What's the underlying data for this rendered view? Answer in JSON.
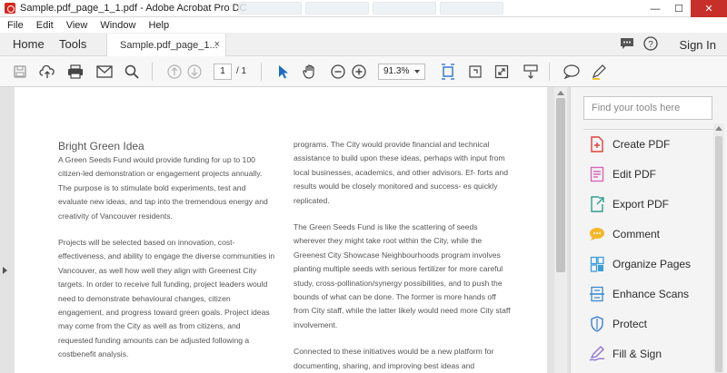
{
  "window": {
    "title": "Sample.pdf_page_1_1.pdf - Adobe Acrobat Pro DC",
    "minimize": "—",
    "maximize": "☐",
    "close": "✕"
  },
  "menu": [
    "File",
    "Edit",
    "View",
    "Window",
    "Help"
  ],
  "tabs": {
    "home": "Home",
    "tools": "Tools",
    "document": "Sample.pdf_page_1...",
    "document_close": "×",
    "sign_in": "Sign In"
  },
  "toolbar": {
    "page_current": "1",
    "page_total": "/ 1",
    "zoom": "91.3%"
  },
  "document": {
    "title": "Bright Green Idea",
    "left_paragraphs": [
      "A Green Seeds Fund would provide funding for up to 100 citizen-led demonstration or engagement projects annually. The purpose is to stimulate bold experiments, test and evaluate new ideas, and tap into the tremendous energy and creativity of Vancouver residents.",
      "Projects will be selected based on innovation, cost-effectiveness, and ability to engage the diverse communities in Vancouver, as well how well they align with Greenest City targets. In order to receive full funding, project leaders would need to demonstrate behavioural changes, citizen engagement, and progress toward green goals. Project ideas may come from the City as well as from citizens, and requested funding amounts can be adjusted following a costbenefit analysis."
    ],
    "right_paragraphs": [
      "programs. The City would provide financial and technical assistance to build upon these ideas, perhaps with input from local businesses, academics, and other advisors. Ef- forts and results would be closely monitored and success- es quickly replicated.",
      "The Green Seeds Fund is like the scattering of seeds wherever they might take root within the City, while the Greenest City Showcase Neighbourhoods program involves planting multiple seeds with serious fertilizer for more careful study, cross-pollination/synergy possibilities, and to push the bounds of what can be done. The former is more hands off from City staff, while the latter likely would need more City staff involvement.",
      "Connected to these initiatives would be a new platform for documenting, sharing, and improving best ideas and"
    ]
  },
  "tools_pane": {
    "search_placeholder": "Find your tools here",
    "items": [
      {
        "label": "Create PDF",
        "icon": "create-pdf-icon",
        "color": "#e0413a"
      },
      {
        "label": "Edit PDF",
        "icon": "edit-pdf-icon",
        "color": "#d766b5"
      },
      {
        "label": "Export PDF",
        "icon": "export-pdf-icon",
        "color": "#2f9e8f"
      },
      {
        "label": "Comment",
        "icon": "comment-icon",
        "color": "#f2b72b"
      },
      {
        "label": "Organize Pages",
        "icon": "organize-pages-icon",
        "color": "#3b9ed8"
      },
      {
        "label": "Enhance Scans",
        "icon": "enhance-scans-icon",
        "color": "#3b8bd0"
      },
      {
        "label": "Protect",
        "icon": "protect-icon",
        "color": "#3b7fd0"
      },
      {
        "label": "Fill & Sign",
        "icon": "fill-sign-icon",
        "color": "#8c6ad1"
      }
    ]
  }
}
